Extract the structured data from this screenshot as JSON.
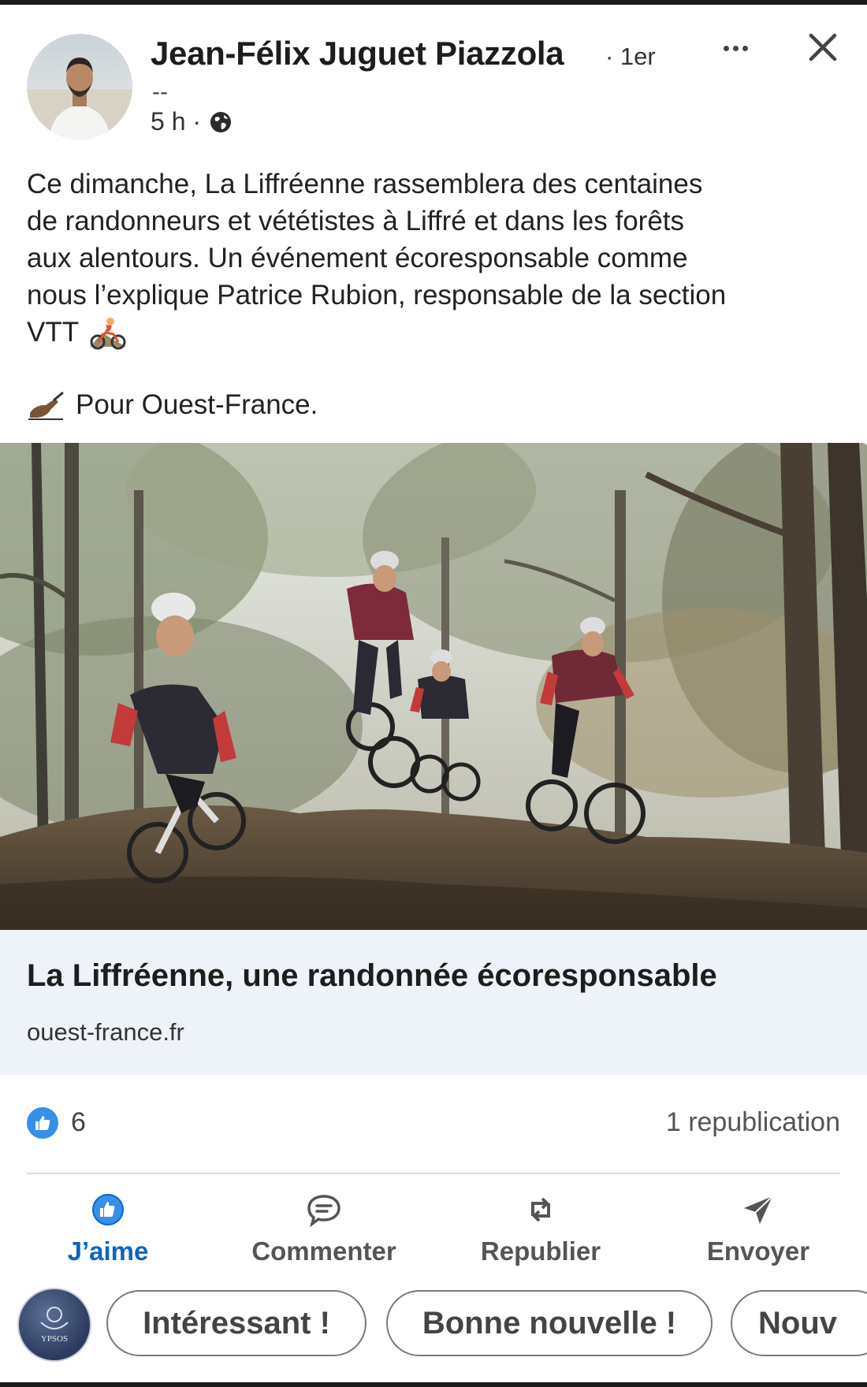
{
  "post": {
    "author": {
      "name": "Jean-Félix Juguet Piazzola",
      "degree": "· 1er",
      "subtitle": "--",
      "time": "5 h ·",
      "icons": {
        "visibility": "globe-icon",
        "more": "more-options-icon",
        "close": "close-icon"
      }
    },
    "text": {
      "line1": "Ce dimanche, La Liffréenne rassemblera des centaines",
      "line2": "de randonneurs et vététistes à Liffré et dans les forêts",
      "line3": "aux alentours. Un événement écoresponsable comme",
      "line4": "nous l’explique Patrice Rubion, responsable de la section",
      "line5": "VTT",
      "emoji": "mountain-biker-emoji"
    },
    "byline": {
      "text": "Pour Ouest-France.",
      "emoji": "writing-hand-emoji"
    },
    "image": {
      "subject": "mountain-bikers-in-forest-photo"
    },
    "link_preview": {
      "title": "La Liffréenne, une randonnée écoresponsable",
      "domain": "ouest-france.fr"
    },
    "social": {
      "likes": "6",
      "reposts": "1 republication"
    }
  },
  "actions": [
    {
      "label": "J’aime",
      "icon": "thumbs-up-icon",
      "active": true
    },
    {
      "label": "Commenter",
      "icon": "comment-icon",
      "active": false
    },
    {
      "label": "Republier",
      "icon": "repost-icon",
      "active": false
    },
    {
      "label": "Envoyer",
      "icon": "send-icon",
      "active": false
    }
  ],
  "suggestions": {
    "avatar_text": "YPSOS",
    "chips": [
      "Intéressant !",
      "Bonne nouvelle !",
      "Nouv"
    ]
  },
  "colors": {
    "accent": "#0a66c2",
    "like_badge": "#378fe9",
    "link_card_bg": "#edf3f8"
  }
}
